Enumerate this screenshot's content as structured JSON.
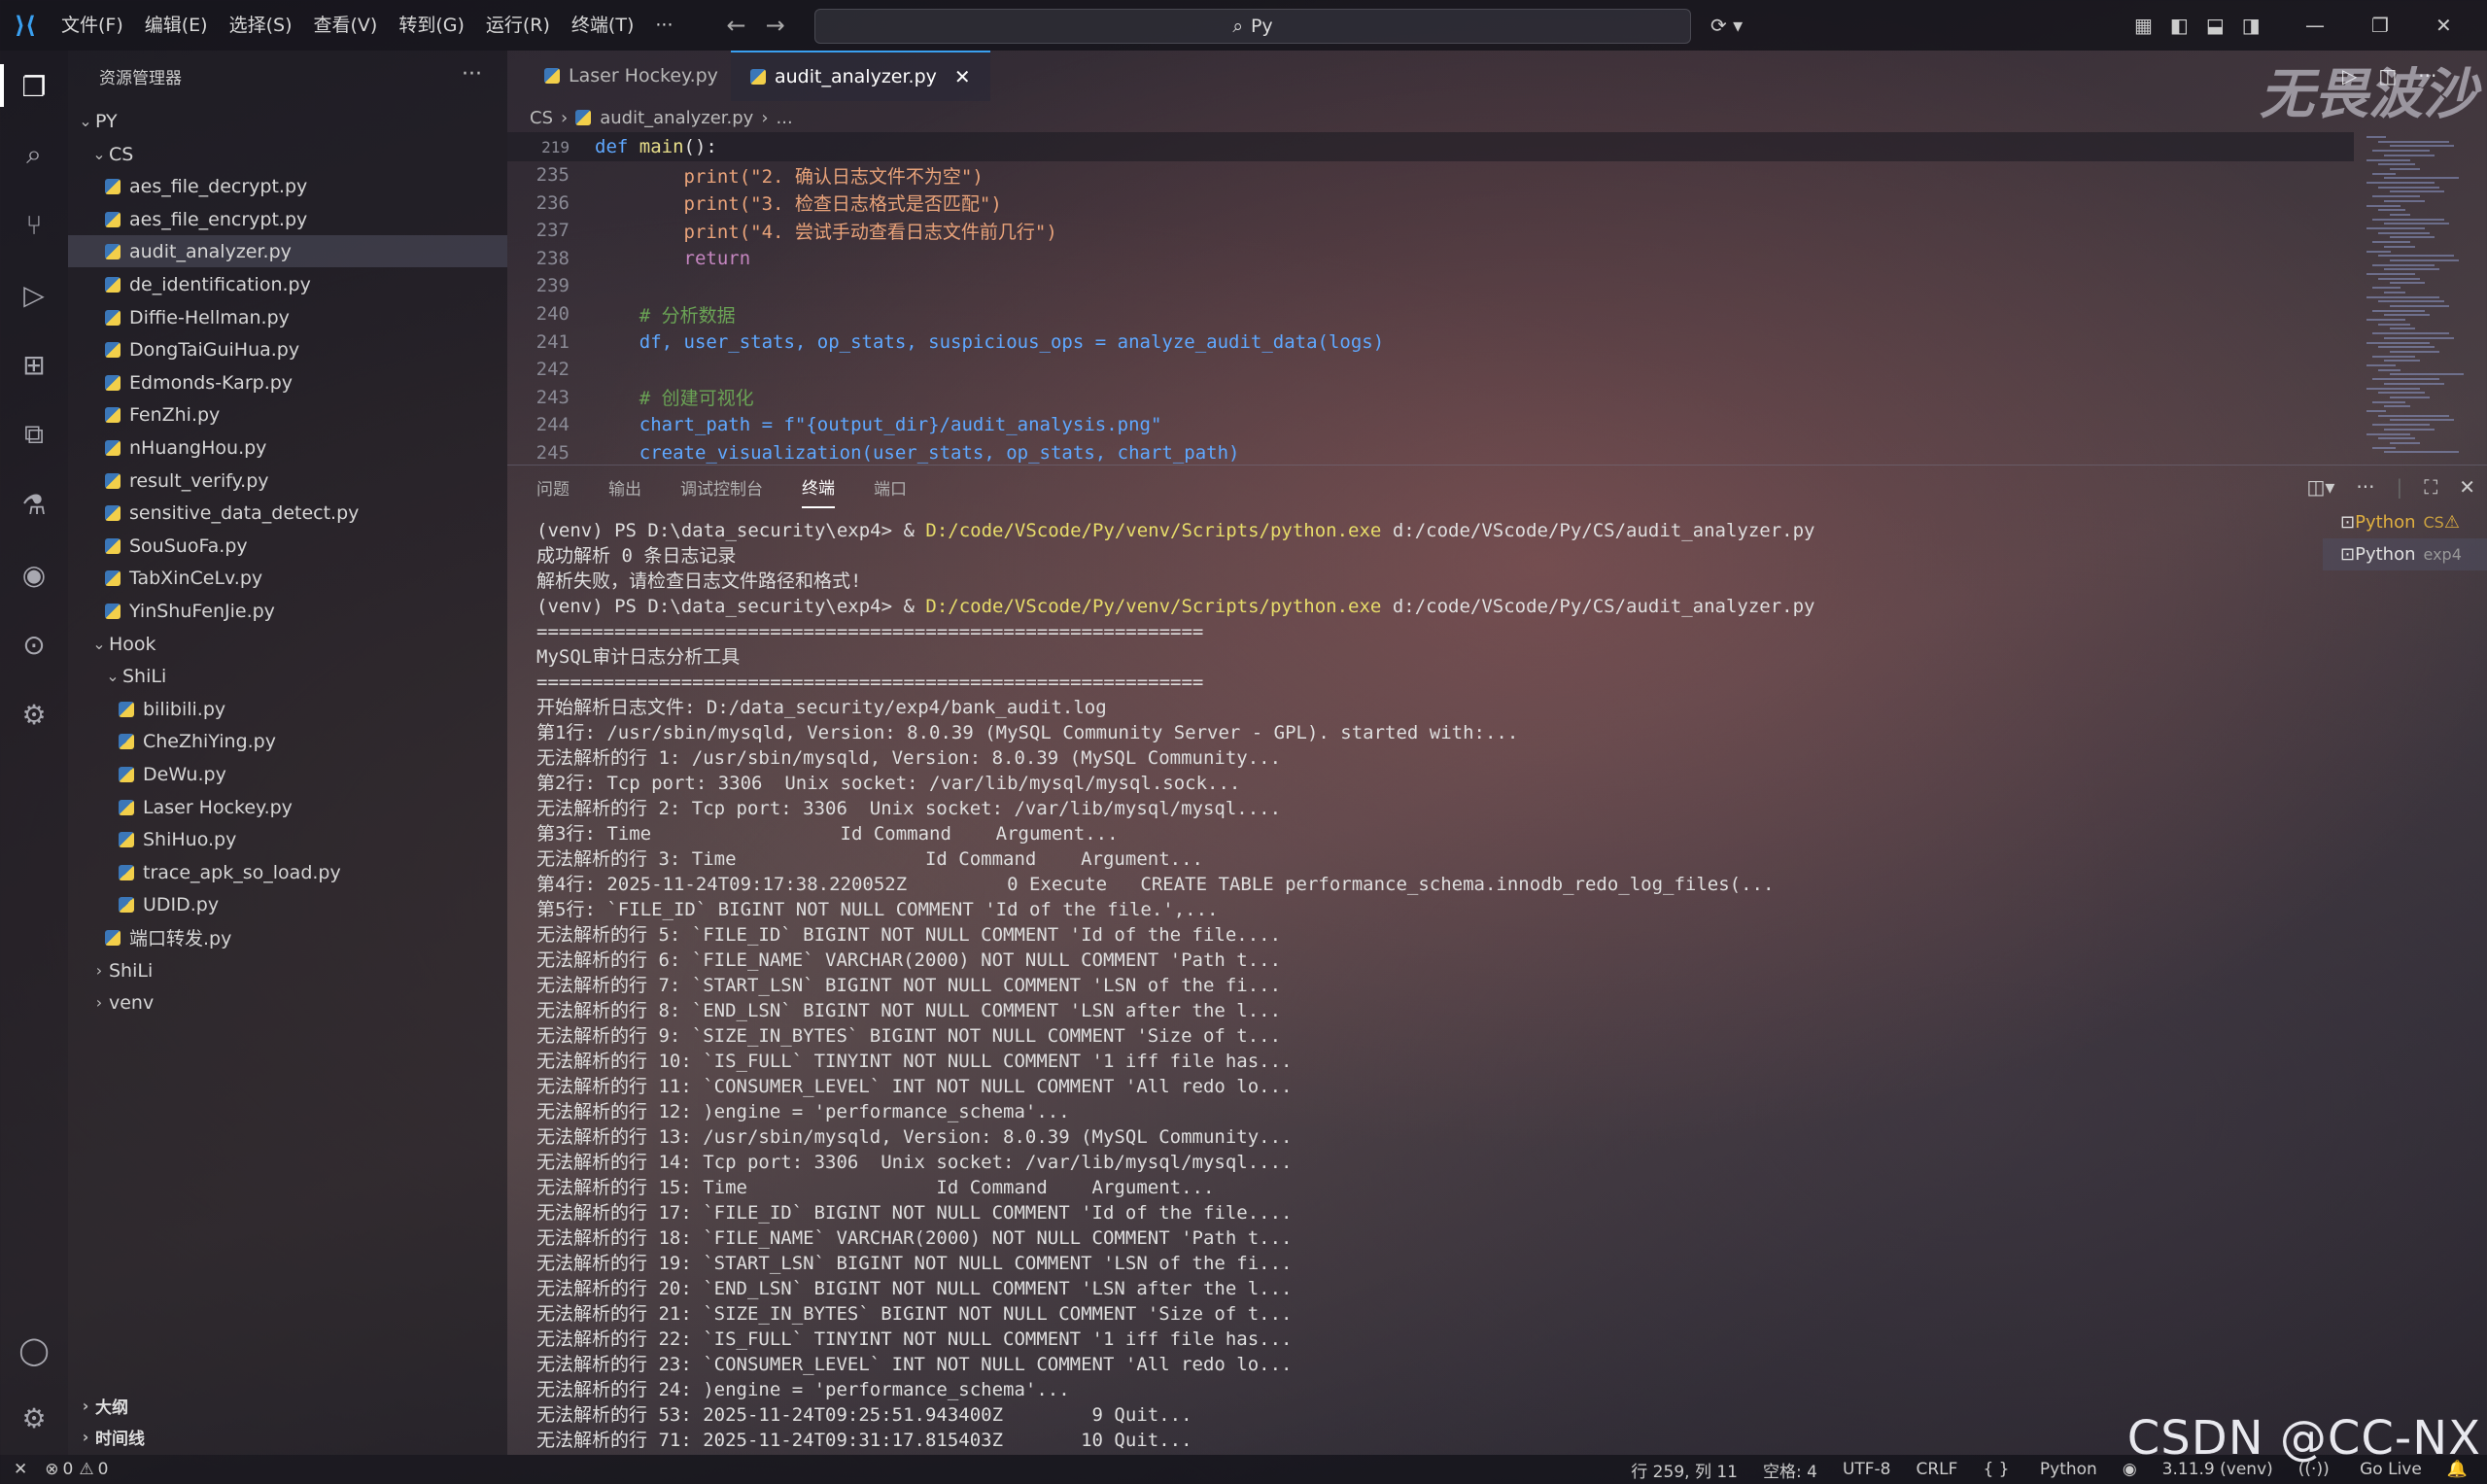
{
  "titlebar": {
    "menus": [
      "文件(F)",
      "编辑(E)",
      "选择(S)",
      "查看(V)",
      "转到(G)",
      "运行(R)",
      "终端(T)",
      "···"
    ],
    "search": "Py"
  },
  "sidebar": {
    "title": "资源管理器",
    "root": "PY",
    "cs_folder": "CS",
    "cs_files": [
      "aes_file_decrypt.py",
      "aes_file_encrypt.py",
      "audit_analyzer.py",
      "de_identification.py",
      "Diffie-Hellman.py",
      "DongTaiGuiHua.py",
      "Edmonds-Karp.py",
      "FenZhi.py",
      "nHuangHou.py",
      "result_verify.py",
      "sensitive_data_detect.py",
      "SouSuoFa.py",
      "TabXinCeLv.py",
      "YinShuFenJie.py"
    ],
    "hook_folder": "Hook",
    "shili_sub": "ShiLi",
    "hook_files": [
      "bilibili.py",
      "CheZhiYing.py",
      "DeWu.py",
      "Laser Hockey.py",
      "ShiHuo.py",
      "trace_apk_so_load.py",
      "UDID.py"
    ],
    "hook_extra": "端口转发.py",
    "other_folders": [
      "ShiLi",
      "venv"
    ],
    "outline": "大纲",
    "timeline": "时间线"
  },
  "editor": {
    "tabs": [
      "Laser Hockey.py",
      "audit_analyzer.py"
    ],
    "breadcrumb": [
      "CS",
      "audit_analyzer.py",
      "..."
    ],
    "sticky_ln": "219",
    "sticky_kw": "def",
    "sticky_fn": "main",
    "sticky_rest": "():",
    "lines": [
      {
        "n": "235",
        "t": "        print(\"2. 确认日志文件不为空\")"
      },
      {
        "n": "236",
        "t": "        print(\"3. 检查日志格式是否匹配\")"
      },
      {
        "n": "237",
        "t": "        print(\"4. 尝试手动查看日志文件前几行\")"
      },
      {
        "n": "238",
        "t": "        return"
      },
      {
        "n": "239",
        "t": ""
      },
      {
        "n": "240",
        "t": "    # 分析数据"
      },
      {
        "n": "241",
        "t": "    df, user_stats, op_stats, suspicious_ops = analyze_audit_data(logs)"
      },
      {
        "n": "242",
        "t": ""
      },
      {
        "n": "243",
        "t": "    # 创建可视化"
      },
      {
        "n": "244",
        "t": "    chart_path = f\"{output_dir}/audit_analysis.png\""
      },
      {
        "n": "245",
        "t": "    create_visualization(user_stats, op_stats, chart_path)"
      }
    ]
  },
  "panel": {
    "tabs": [
      "问题",
      "输出",
      "调试控制台",
      "终端",
      "端口"
    ],
    "terminals": [
      {
        "name": "Python",
        "sub": "CS"
      },
      {
        "name": "Python",
        "sub": "exp4"
      }
    ],
    "prompt": "(venv) PS D:\\data_security\\exp4> & ",
    "exe": "D:/code/VScode/Py/venv/Scripts/python.exe",
    "script": " d:/code/VScode/Py/CS/audit_analyzer.py",
    "lines": [
      "成功解析 0 条日志记录",
      "解析失败，请检查日志文件路径和格式!",
      "============================================================",
      "MySQL审计日志分析工具",
      "============================================================",
      "开始解析日志文件: D:/data_security/exp4/bank_audit.log",
      "第1行: /usr/sbin/mysqld, Version: 8.0.39 (MySQL Community Server - GPL). started with:...",
      "无法解析的行 1: /usr/sbin/mysqld, Version: 8.0.39 (MySQL Community...",
      "第2行: Tcp port: 3306  Unix socket: /var/lib/mysql/mysql.sock...",
      "无法解析的行 2: Tcp port: 3306  Unix socket: /var/lib/mysql/mysql....",
      "第3行: Time                 Id Command    Argument...",
      "无法解析的行 3: Time                 Id Command    Argument...",
      "第4行: 2025-11-24T09:17:38.220052Z         0 Execute   CREATE TABLE performance_schema.innodb_redo_log_files(...",
      "第5行: `FILE_ID` BIGINT NOT NULL COMMENT 'Id of the file.',...",
      "无法解析的行 5: `FILE_ID` BIGINT NOT NULL COMMENT 'Id of the file....",
      "无法解析的行 6: `FILE_NAME` VARCHAR(2000) NOT NULL COMMENT 'Path t...",
      "无法解析的行 7: `START_LSN` BIGINT NOT NULL COMMENT 'LSN of the fi...",
      "无法解析的行 8: `END_LSN` BIGINT NOT NULL COMMENT 'LSN after the l...",
      "无法解析的行 9: `SIZE_IN_BYTES` BIGINT NOT NULL COMMENT 'Size of t...",
      "无法解析的行 10: `IS_FULL` TINYINT NOT NULL COMMENT '1 iff file has...",
      "无法解析的行 11: `CONSUMER_LEVEL` INT NOT NULL COMMENT 'All redo lo...",
      "无法解析的行 12: )engine = 'performance_schema'...",
      "无法解析的行 13: /usr/sbin/mysqld, Version: 8.0.39 (MySQL Community...",
      "无法解析的行 14: Tcp port: 3306  Unix socket: /var/lib/mysql/mysql....",
      "无法解析的行 15: Time                 Id Command    Argument...",
      "无法解析的行 17: `FILE_ID` BIGINT NOT NULL COMMENT 'Id of the file....",
      "无法解析的行 18: `FILE_NAME` VARCHAR(2000) NOT NULL COMMENT 'Path t...",
      "无法解析的行 19: `START_LSN` BIGINT NOT NULL COMMENT 'LSN of the fi...",
      "无法解析的行 20: `END_LSN` BIGINT NOT NULL COMMENT 'LSN after the l...",
      "无法解析的行 21: `SIZE_IN_BYTES` BIGINT NOT NULL COMMENT 'Size of t...",
      "无法解析的行 22: `IS_FULL` TINYINT NOT NULL COMMENT '1 iff file has...",
      "无法解析的行 23: `CONSUMER_LEVEL` INT NOT NULL COMMENT 'All redo lo...",
      "无法解析的行 24: )engine = 'performance_schema'...",
      "无法解析的行 53: 2025-11-24T09:25:51.943400Z        9 Quit...",
      "无法解析的行 71: 2025-11-24T09:31:17.815403Z       10 Quit..."
    ]
  },
  "statusbar": {
    "errors": "0",
    "warnings": "0",
    "position": "行 259, 列 11",
    "spaces": "空格: 4",
    "encoding": "UTF-8",
    "eol": "CRLF",
    "language": "Python",
    "interpreter": "3.11.9 (venv)",
    "golive": "Go Live"
  },
  "watermark": "CSDN @CC-NX",
  "corner_logo": "无畏波沙",
  "colors": {
    "accent": "#3aa0f0",
    "path": "#e7dc6a",
    "keyword": "#5fa8ff",
    "function": "#e8df8a",
    "string": "#e9a37a",
    "comment": "#6aa355"
  }
}
